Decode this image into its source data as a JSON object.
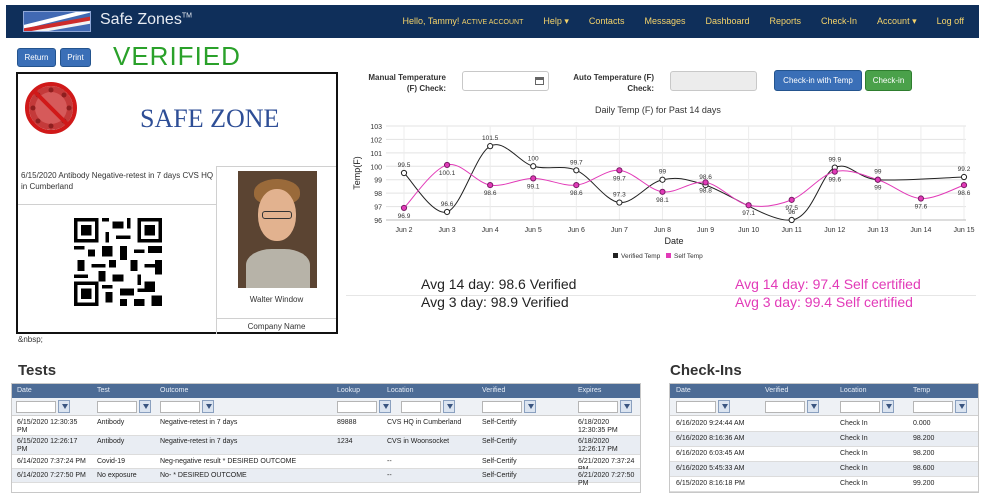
{
  "nav": {
    "brand": "Safe Zones",
    "tm": "TM",
    "greeting": "Hello, Tammy!",
    "account_status": "ACTIVE ACCOUNT",
    "help": "Help",
    "contacts": "Contacts",
    "messages": "Messages",
    "dashboard": "Dashboard",
    "reports": "Reports",
    "checkin": "Check-In",
    "account": "Account",
    "logoff": "Log off"
  },
  "toolbar": {
    "return_label": "Return",
    "print_label": "Print",
    "status": "VERIFIED"
  },
  "card": {
    "title": "SAFE ZONE",
    "note": "6/15/2020 Antibody Negative-retest in 7 days CVS HQ in Cumberland",
    "person_name": "Walter Window",
    "company": "Company Name",
    "nbsp_text": "&nbsp;"
  },
  "checkin_form": {
    "manual_label_1": "Manual Temperature",
    "manual_label_2": "(F) Check:",
    "auto_label_1": "Auto Temperature (F)",
    "auto_label_2": "Check:",
    "manual_value": "",
    "auto_value": "",
    "checkin_temp_label": "Check-in with Temp",
    "checkin_label": "Check-in"
  },
  "chart_data": {
    "type": "line",
    "title": "Daily Temp (F) for Past 14 days",
    "xlabel": "Date",
    "ylabel": "Temp(F)",
    "ylim": [
      96,
      103
    ],
    "yticks": [
      "96",
      "97",
      "98",
      "99",
      "100",
      "101",
      "102",
      "103"
    ],
    "categories": [
      "Jun 2",
      "Jun 3",
      "Jun 4",
      "Jun 5",
      "Jun 6",
      "Jun 7",
      "Jun 8",
      "Jun 9",
      "Jun 10",
      "Jun 11",
      "Jun 12",
      "Jun 13",
      "Jun 14",
      "Jun 15"
    ],
    "legend_position": "bottom",
    "series": [
      {
        "name": "Verified Temp",
        "color": "#222222",
        "points": [
          [
            0,
            99.5
          ],
          [
            1,
            96.6
          ],
          [
            2,
            101.5
          ],
          [
            3,
            100
          ],
          [
            4,
            99.7
          ],
          [
            5,
            97.3
          ],
          [
            6,
            99
          ],
          [
            7,
            98.6
          ],
          [
            9,
            96
          ],
          [
            10,
            99.9
          ],
          [
            11,
            99
          ],
          [
            13,
            99.2
          ]
        ],
        "labels": [
          [
            "99.5",
            0
          ],
          [
            "96.6",
            1
          ],
          [
            "101.5",
            2
          ],
          [
            "100",
            3
          ],
          [
            "99.7",
            4
          ],
          [
            "97.3",
            5
          ],
          [
            "99",
            6
          ],
          [
            "98.6",
            7
          ],
          [
            "96",
            9
          ],
          [
            "99.9",
            10
          ],
          [
            "99",
            11
          ],
          [
            "99.2",
            13
          ]
        ]
      },
      {
        "name": "Self Temp",
        "color": "#e23ab8",
        "points": [
          [
            0,
            96.9
          ],
          [
            1,
            100.1
          ],
          [
            2,
            98.6
          ],
          [
            3,
            99.1
          ],
          [
            4,
            98.6
          ],
          [
            5,
            99.7
          ],
          [
            6,
            98.1
          ],
          [
            7,
            98.8
          ],
          [
            8,
            97.1
          ],
          [
            9,
            97.5
          ],
          [
            10,
            99.6
          ],
          [
            11,
            99
          ],
          [
            12,
            97.6
          ],
          [
            13,
            98.6
          ]
        ],
        "labels": [
          [
            "96.9",
            0
          ],
          [
            "100.1",
            1
          ],
          [
            "98.6",
            2
          ],
          [
            "99.1",
            3
          ],
          [
            "98.6",
            4
          ],
          [
            "99.7",
            5
          ],
          [
            "98.1",
            6
          ],
          [
            "98.8",
            7
          ],
          [
            "97.1",
            8
          ],
          [
            "97.5",
            9
          ],
          [
            "99.6",
            10
          ],
          [
            "99",
            11
          ],
          [
            "97.6",
            12
          ],
          [
            "98.6",
            13
          ]
        ]
      }
    ]
  },
  "averages": {
    "avg14_verified": "Avg 14 day: 98.6 Verified",
    "avg3_verified": "Avg 3 day: 98.9 Verified",
    "avg14_self": "Avg 14 day: 97.4 Self certified",
    "avg3_self": "Avg 3 day: 99.4 Self certified"
  },
  "tests": {
    "title": "Tests",
    "columns": [
      "Date",
      "Test",
      "Outcome",
      "Lookup",
      "Location",
      "Verified",
      "Expires"
    ],
    "rows": [
      [
        "6/15/2020 12:30:35 PM",
        "Antibody",
        "Negative-retest in 7 days",
        "89888",
        "CVS HQ in Cumberland",
        "Self-Certify",
        "6/18/2020 12:30:35 PM"
      ],
      [
        "6/15/2020 12:26:17 PM",
        "Antibody",
        "Negative-retest in 7 days",
        "1234",
        "CVS in Woonsocket",
        "Self-Certify",
        "6/18/2020 12:26:17 PM"
      ],
      [
        "6/14/2020 7:37:24 PM",
        "Covid-19",
        "Neg-negative result * DESIRED OUTCOME",
        "",
        "--",
        "Self-Certify",
        "6/21/2020 7:37:24 PM"
      ],
      [
        "6/14/2020 7:27:50 PM",
        "No exposure",
        "No- * DESIRED OUTCOME",
        "",
        "--",
        "Self-Certify",
        "6/21/2020 7:27:50 PM"
      ]
    ]
  },
  "checkins": {
    "title": "Check-Ins",
    "columns": [
      "Date",
      "Verified",
      "Location",
      "Temp"
    ],
    "rows": [
      [
        "6/16/2020 9:24:44 AM",
        "",
        "Check In",
        "0.000"
      ],
      [
        "6/16/2020 8:16:36 AM",
        "",
        "Check In",
        "98.200"
      ],
      [
        "6/16/2020 6:03:45 AM",
        "",
        "Check In",
        "98.200"
      ],
      [
        "6/16/2020 5:45:33 AM",
        "",
        "Check In",
        "98.600"
      ],
      [
        "6/15/2020 8:16:18 PM",
        "",
        "Check In",
        "99.200"
      ]
    ]
  }
}
